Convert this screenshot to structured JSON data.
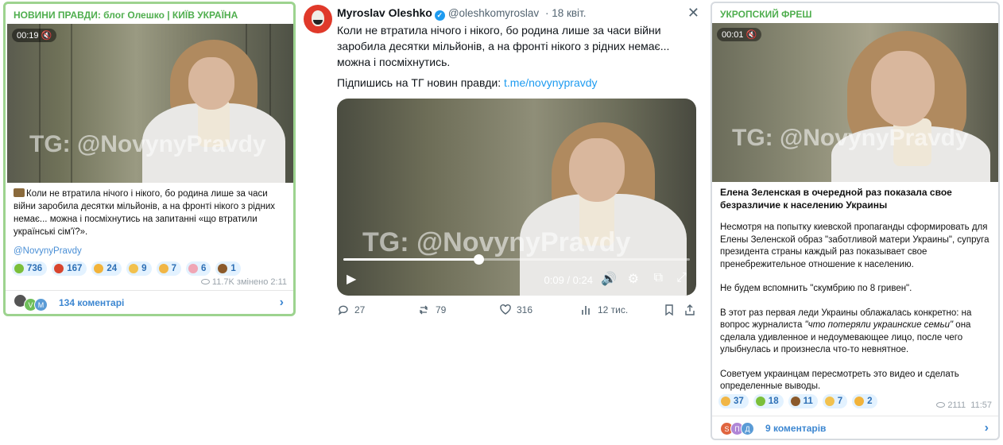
{
  "panel1": {
    "channel": "НОВИНИ ПРАВДИ: блог Олешко | КИЇВ УКРАЇНА",
    "video_time": "00:19",
    "watermark": "TG: @NovynyPravdy",
    "text": "Коли не втратила нічого і нікого, бо родина лише за часи війни заробила десятки мільйонів, а на фронті нікого з рідних немає... можна і посміхнутись на запитанні «що втратили українські сім'ї?».",
    "link": "@NovynyPravdy",
    "reactions": [
      {
        "count": "736",
        "color": "#7bbf3a",
        "icon": "green-figure-icon"
      },
      {
        "count": "167",
        "color": "#d8452e",
        "icon": "angry-face-icon"
      },
      {
        "count": "24",
        "color": "#f2b33a",
        "icon": "shocked-face-icon"
      },
      {
        "count": "9",
        "color": "#f2c14e",
        "icon": "thumbs-up-icon"
      },
      {
        "count": "7",
        "color": "#f1b646",
        "icon": "grimace-face-icon"
      },
      {
        "count": "6",
        "color": "#f0a6b5",
        "icon": "pig-icon"
      },
      {
        "count": "1",
        "color": "#8b5a2b",
        "icon": "poop-icon"
      }
    ],
    "views": "11.7K",
    "edited": "змінено 2:11",
    "comments_avatars": [
      {
        "letter": "",
        "color": "#555555"
      },
      {
        "letter": "V",
        "color": "#6fbf5a"
      },
      {
        "letter": "M",
        "color": "#5a9bd6"
      }
    ],
    "comments": "134 коментарі"
  },
  "panel2": {
    "name": "Myroslav Oleshko",
    "handle": "@oleshkomyroslav",
    "date": "· 18 квіт.",
    "text": "Коли не втратила нічого і нікого, бо родина лише за часи війни заробила десятки мільйонів, а на фронті нікого з рідних немає... можна і посміхнутись.",
    "subscribe_prefix": "Підпишись на ТГ новин правди: ",
    "subscribe_link": "t.me/novynypravdy",
    "watermark": "TG: @NovynyPravdy",
    "video_time": "0:09 / 0:24",
    "progress": 0.39,
    "actions": {
      "replies": "27",
      "reposts": "79",
      "likes": "316",
      "views": "12 тис."
    }
  },
  "panel3": {
    "channel": "УКРОПСКИЙ ФРЕШ",
    "video_time": "00:01",
    "watermark": "TG: @NovynyPravdy",
    "title": "Елена Зеленская в очередной раз показала свое безразличие к населению Украины",
    "para1": "Несмотря на попытку киевской пропаганды сформировать для Елены Зеленской образ \"заботливой матери Украины\", супруга президента страны каждый раз показывает свое пренебрежительное отношение к населению.",
    "para2": "Не будем вспомнить \"скумбрию по 8 гривен\".",
    "para3_pre": "В этот раз первая леди Украины облажалась конкретно: на вопрос журналиста ",
    "para3_quote": "\"что потеряли украинские семьи\"",
    "para3_post": " она сделала удивленное и недоумевающее лицо, после чего улыбнулась и произнесла что-то невнятное.",
    "para4": "Советуем украинцам пересмотреть это видео и сделать определенные выводы.",
    "reactions": [
      {
        "count": "37",
        "color": "#f1b646",
        "icon": "grimace-face-icon"
      },
      {
        "count": "18",
        "color": "#7bbf3a",
        "icon": "green-figure-icon"
      },
      {
        "count": "11",
        "color": "#8b5a2b",
        "icon": "poop-icon"
      },
      {
        "count": "7",
        "color": "#f2c14e",
        "icon": "thumbs-up-icon"
      },
      {
        "count": "2",
        "color": "#f2b33a",
        "icon": "yawn-face-icon"
      }
    ],
    "views": "2111",
    "time": "11:57",
    "comments_avatars": [
      {
        "letter": "S",
        "color": "#e0653f"
      },
      {
        "letter": "П",
        "color": "#b086d6"
      },
      {
        "letter": "Д",
        "color": "#5a9bd6"
      }
    ],
    "comments": "9 коментарів"
  }
}
